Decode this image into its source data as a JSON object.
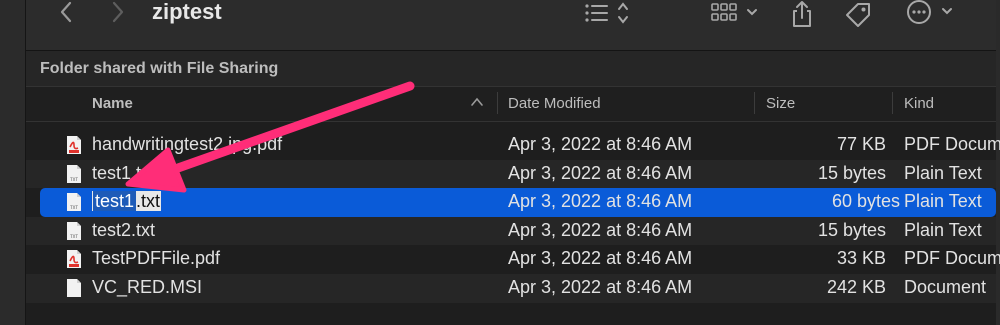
{
  "window": {
    "title": "ziptest"
  },
  "toolbar": {
    "back_icon": "chevron-left-icon",
    "forward_icon": "chevron-right-icon",
    "view_icon": "list-view-icon",
    "group_icon": "grid-group-icon",
    "share_icon": "share-icon",
    "tag_icon": "tag-icon",
    "more_icon": "ellipsis-circle-icon"
  },
  "subheader": {
    "text": "Folder shared with File Sharing"
  },
  "columns": {
    "name": "Name",
    "date": "Date Modified",
    "size": "Size",
    "kind": "Kind"
  },
  "files": [
    {
      "name": "handwritingtest2.jpg.pdf",
      "date": "Apr 3, 2022 at 8:46 AM",
      "size": "77 KB",
      "kind": "PDF Docum",
      "icon": "pdf-file-icon"
    },
    {
      "name": "test1.txt",
      "date": "Apr 3, 2022 at 8:46 AM",
      "size": "15 bytes",
      "kind": "Plain Text",
      "icon": "text-file-icon"
    },
    {
      "name_highlighted": "test1",
      "name_rest": ".txt",
      "date": "Apr 3, 2022 at 8:46 AM",
      "size": "60 bytes",
      "kind": "Plain Text",
      "icon": "text-file-icon"
    },
    {
      "name": "test2.txt",
      "date": "Apr 3, 2022 at 8:46 AM",
      "size": "15 bytes",
      "kind": "Plain Text",
      "icon": "text-file-icon"
    },
    {
      "name": "TestPDFFile.pdf",
      "date": "Apr 3, 2022 at 8:46 AM",
      "size": "33 KB",
      "kind": "PDF Docum",
      "icon": "pdf-file-icon"
    },
    {
      "name": "VC_RED.MSI",
      "date": "Apr 3, 2022 at 8:46 AM",
      "size": "242 KB",
      "kind": "Document",
      "icon": "generic-file-icon"
    }
  ],
  "colors": {
    "selection": "#0a5bd8",
    "annotation_arrow": "#ff2d78"
  }
}
